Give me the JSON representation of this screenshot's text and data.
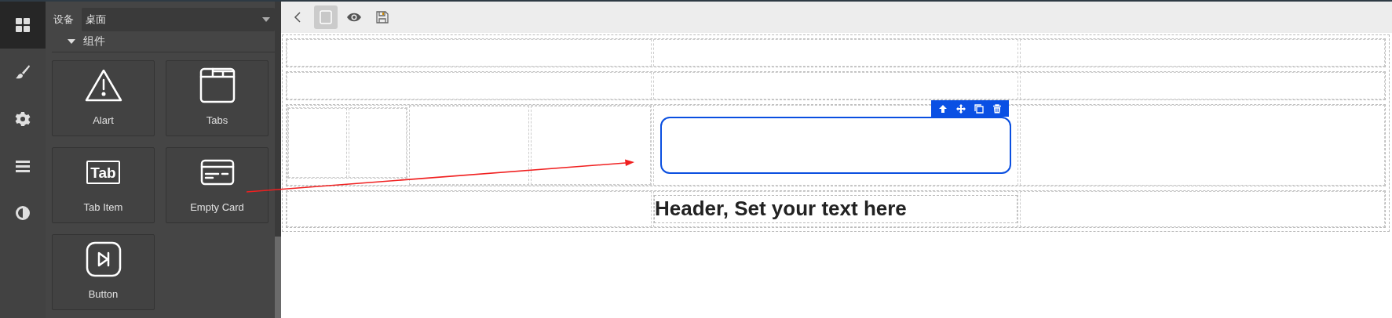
{
  "rail": {
    "items": [
      {
        "kind": "blocks",
        "selected": true
      },
      {
        "kind": "style",
        "selected": false
      },
      {
        "kind": "settings",
        "selected": false
      },
      {
        "kind": "layers",
        "selected": false
      },
      {
        "kind": "theme",
        "selected": false
      }
    ]
  },
  "panel": {
    "device": {
      "label": "设备",
      "value": "桌面"
    },
    "category": {
      "label": "组件",
      "expanded": true
    },
    "blocks": [
      {
        "kind": "alert",
        "label": "Alart"
      },
      {
        "kind": "tabs",
        "label": "Tabs"
      },
      {
        "kind": "tab",
        "label": "Tab Item",
        "icon_text": "Tab"
      },
      {
        "kind": "card",
        "label": "Empty Card"
      },
      {
        "kind": "button",
        "label": "Button"
      }
    ]
  },
  "toolbar": {
    "buttons": [
      {
        "kind": "back",
        "selected": false
      },
      {
        "kind": "outline",
        "selected": true
      },
      {
        "kind": "preview",
        "selected": false
      },
      {
        "kind": "save",
        "selected": false
      }
    ]
  },
  "canvas": {
    "rows": [
      {
        "cells": [
          {
            "kind": "empty"
          },
          {
            "kind": "empty"
          },
          {
            "kind": "empty"
          }
        ]
      },
      {
        "cells": [
          {
            "kind": "empty"
          },
          {
            "kind": "empty"
          },
          {
            "kind": "empty"
          }
        ]
      },
      {
        "cells": [
          {
            "kind": "split",
            "children": [
              {
                "kind": "split",
                "children": [
                  {
                    "kind": "empty"
                  },
                  {
                    "kind": "empty"
                  }
                ]
              },
              {
                "kind": "empty"
              },
              {
                "kind": "empty"
              }
            ]
          },
          {
            "kind": "card",
            "selected": true,
            "actions": [
              {
                "kind": "up"
              },
              {
                "kind": "move"
              },
              {
                "kind": "copy"
              },
              {
                "kind": "delete"
              }
            ]
          },
          {
            "kind": "empty"
          }
        ]
      },
      {
        "cells": [
          {
            "kind": "empty"
          },
          {
            "kind": "heading",
            "text": "Header, Set your text here"
          },
          {
            "kind": "empty"
          }
        ]
      }
    ]
  },
  "annotations": [
    {
      "kind": "arrow"
    }
  ]
}
